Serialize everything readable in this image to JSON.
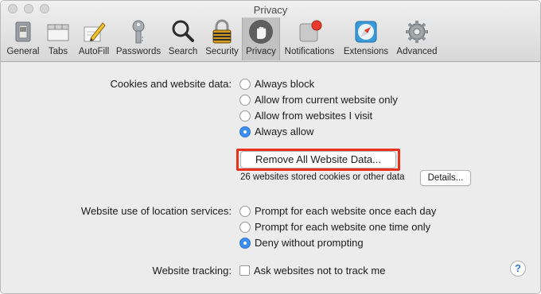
{
  "window": {
    "title": "Privacy"
  },
  "toolbar": {
    "items": [
      {
        "label": "General",
        "icon": "switch-icon"
      },
      {
        "label": "Tabs",
        "icon": "tabs-icon"
      },
      {
        "label": "AutoFill",
        "icon": "pencil-icon"
      },
      {
        "label": "Passwords",
        "icon": "key-icon"
      },
      {
        "label": "Search",
        "icon": "magnifier-icon"
      },
      {
        "label": "Security",
        "icon": "padlock-icon"
      },
      {
        "label": "Privacy",
        "icon": "hand-icon"
      },
      {
        "label": "Notifications",
        "icon": "notification-icon"
      },
      {
        "label": "Extensions",
        "icon": "compass-icon"
      },
      {
        "label": "Advanced",
        "icon": "gear-icon"
      }
    ],
    "selected": "Privacy"
  },
  "cookies": {
    "label": "Cookies and website data:",
    "options": [
      {
        "label": "Always block",
        "selected": false
      },
      {
        "label": "Allow from current website only",
        "selected": false
      },
      {
        "label": "Allow from websites I visit",
        "selected": false
      },
      {
        "label": "Always allow",
        "selected": true
      }
    ],
    "remove_button": "Remove All Website Data...",
    "stored_text": "26 websites stored cookies or other data",
    "details_button": "Details..."
  },
  "location": {
    "label": "Website use of location services:",
    "options": [
      {
        "label": "Prompt for each website once each day",
        "selected": false
      },
      {
        "label": "Prompt for each website one time only",
        "selected": false
      },
      {
        "label": "Deny without prompting",
        "selected": true
      }
    ]
  },
  "tracking": {
    "label": "Website tracking:",
    "checkbox_label": "Ask websites not to track me",
    "checked": false
  },
  "help": {
    "glyph": "?"
  },
  "colors": {
    "accent": "#3c8ef3",
    "highlight": "#e8321e",
    "notification_badge": "#e8392d"
  }
}
